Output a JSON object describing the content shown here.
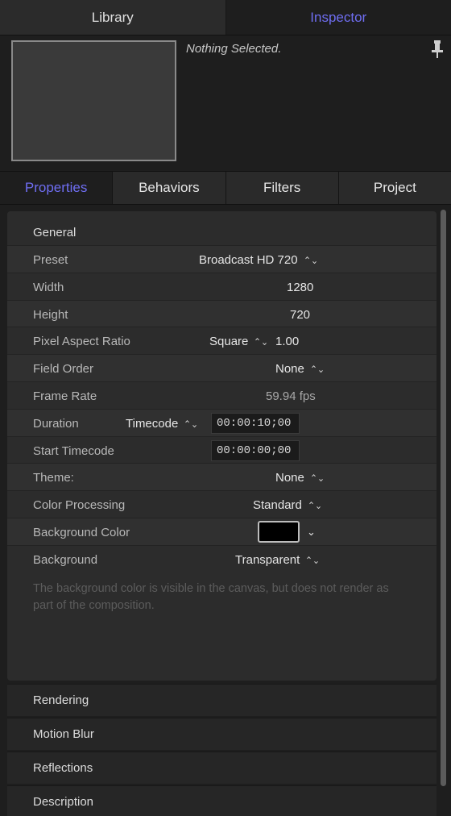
{
  "top_tabs": [
    {
      "label": "Library",
      "active": false
    },
    {
      "label": "Inspector",
      "active": true
    }
  ],
  "preview": {
    "status_text": "Nothing Selected."
  },
  "sub_tabs": [
    {
      "label": "Properties",
      "active": true
    },
    {
      "label": "Behaviors",
      "active": false
    },
    {
      "label": "Filters",
      "active": false
    },
    {
      "label": "Project",
      "active": false
    }
  ],
  "general": {
    "title": "General",
    "preset": {
      "label": "Preset",
      "value": "Broadcast HD 720"
    },
    "width": {
      "label": "Width",
      "value": "1280"
    },
    "height": {
      "label": "Height",
      "value": "720"
    },
    "pixel_aspect": {
      "label": "Pixel Aspect Ratio",
      "mode": "Square",
      "value": "1.00"
    },
    "field_order": {
      "label": "Field Order",
      "value": "None"
    },
    "frame_rate": {
      "label": "Frame Rate",
      "value": "59.94 fps"
    },
    "duration": {
      "label": "Duration",
      "mode": "Timecode",
      "value": "00:00:10;00"
    },
    "start_timecode": {
      "label": "Start Timecode",
      "value": "00:00:00;00"
    },
    "theme": {
      "label": "Theme:",
      "value": "None"
    },
    "color_processing": {
      "label": "Color Processing",
      "value": "Standard"
    },
    "background_color": {
      "label": "Background Color",
      "color": "#000000"
    },
    "background": {
      "label": "Background",
      "value": "Transparent"
    },
    "note": "The background color is visible in the canvas, but does not render as part of the composition."
  },
  "collapsed_sections": [
    {
      "label": "Rendering"
    },
    {
      "label": "Motion Blur"
    },
    {
      "label": "Reflections"
    },
    {
      "label": "Description"
    }
  ],
  "colors": {
    "accent": "#6f6ef2",
    "panel": "#2c2c2c",
    "background": "#1e1e1e"
  }
}
